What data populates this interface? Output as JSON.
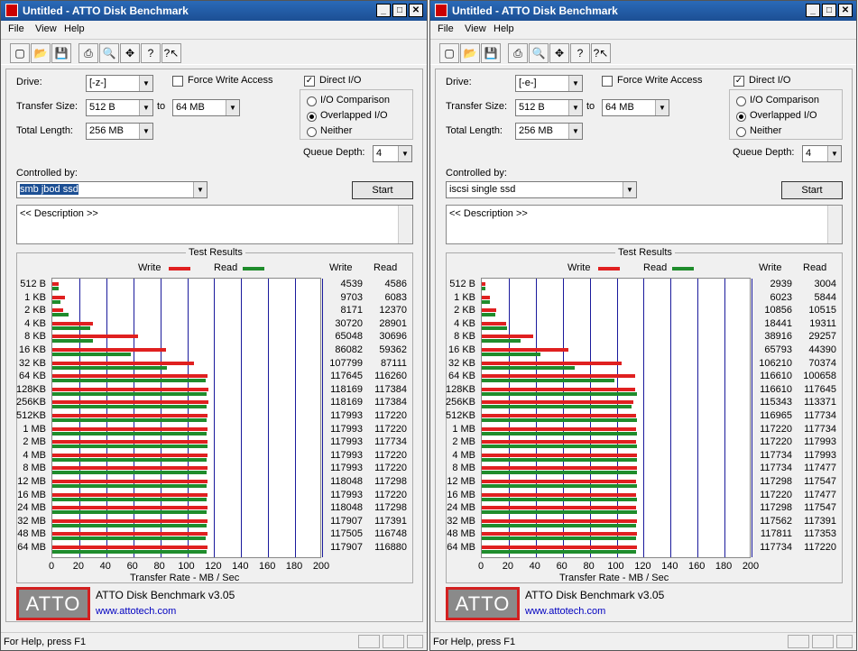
{
  "colors": {
    "write": "#e02020",
    "read": "#1f8c2c",
    "grid": "#1a1a9c"
  },
  "windows": [
    {
      "title": "Untitled - ATTO Disk Benchmark",
      "menu": [
        "File",
        "View",
        "Help"
      ],
      "drive_label": "Drive:",
      "drive": "[-z-]",
      "force_write_label": "Force Write Access",
      "direct_io_label": "Direct I/O",
      "transfer_size_label": "Transfer Size:",
      "ts_from": "512 B",
      "to_label": "to",
      "ts_to": "64 MB",
      "total_length_label": "Total Length:",
      "total_length": "256 MB",
      "io_comparison": "I/O Comparison",
      "overlapped": "Overlapped I/O",
      "neither": "Neither",
      "queue_depth_label": "Queue Depth:",
      "queue_depth": "4",
      "controlled_by_label": "Controlled by:",
      "controlled_by": "smb jbod ssd",
      "start_label": "Start",
      "description": "<< Description >>",
      "test_results_label": "Test Results",
      "write_label": "Write",
      "read_label": "Read",
      "x_axis_label": "Transfer Rate - MB / Sec",
      "product": "ATTO Disk Benchmark v3.05",
      "url": "www.attotech.com",
      "logo": "ATTO",
      "status": "For Help, press F1",
      "chart_data": {
        "type": "bar",
        "title": "Test Results",
        "xlabel": "Transfer Rate - MB / Sec",
        "xlim": [
          0,
          200
        ],
        "x_ticks": [
          "0",
          "20",
          "40",
          "60",
          "80",
          "100",
          "120",
          "140",
          "160",
          "180",
          "200"
        ],
        "categories": [
          "512 B",
          "1 KB",
          "2 KB",
          "4 KB",
          "8 KB",
          "16 KB",
          "32 KB",
          "64 KB",
          "128KB",
          "256KB",
          "512KB",
          "1 MB",
          "2 MB",
          "4 MB",
          "8 MB",
          "12 MB",
          "16 MB",
          "24 MB",
          "32 MB",
          "48 MB",
          "64 MB"
        ],
        "series": [
          {
            "name": "Write",
            "values": [
              "4539",
              "9703",
              "8171",
              "30720",
              "65048",
              "86082",
              "107799",
              "117645",
              "118169",
              "118169",
              "117993",
              "117993",
              "117993",
              "117993",
              "117993",
              "118048",
              "117993",
              "118048",
              "117907",
              "117505",
              "117907"
            ]
          },
          {
            "name": "Read",
            "values": [
              "4586",
              "6083",
              "12370",
              "28901",
              "30696",
              "59362",
              "87111",
              "116260",
              "117384",
              "117384",
              "117220",
              "117220",
              "117734",
              "117220",
              "117220",
              "117298",
              "117220",
              "117298",
              "117391",
              "116748",
              "116880"
            ]
          }
        ]
      }
    },
    {
      "title": "Untitled - ATTO Disk Benchmark",
      "menu": [
        "File",
        "View",
        "Help"
      ],
      "drive_label": "Drive:",
      "drive": "[-e-]",
      "force_write_label": "Force Write Access",
      "direct_io_label": "Direct I/O",
      "transfer_size_label": "Transfer Size:",
      "ts_from": "512 B",
      "to_label": "to",
      "ts_to": "64 MB",
      "total_length_label": "Total Length:",
      "total_length": "256 MB",
      "io_comparison": "I/O Comparison",
      "overlapped": "Overlapped I/O",
      "neither": "Neither",
      "queue_depth_label": "Queue Depth:",
      "queue_depth": "4",
      "controlled_by_label": "Controlled by:",
      "controlled_by": "iscsi single ssd",
      "start_label": "Start",
      "description": "<< Description >>",
      "test_results_label": "Test Results",
      "write_label": "Write",
      "read_label": "Read",
      "x_axis_label": "Transfer Rate - MB / Sec",
      "product": "ATTO Disk Benchmark v3.05",
      "url": "www.attotech.com",
      "logo": "ATTO",
      "status": "For Help, press F1",
      "chart_data": {
        "type": "bar",
        "title": "Test Results",
        "xlabel": "Transfer Rate - MB / Sec",
        "xlim": [
          0,
          200
        ],
        "x_ticks": [
          "0",
          "20",
          "40",
          "60",
          "80",
          "100",
          "120",
          "140",
          "160",
          "180",
          "200"
        ],
        "categories": [
          "512 B",
          "1 KB",
          "2 KB",
          "4 KB",
          "8 KB",
          "16 KB",
          "32 KB",
          "64 KB",
          "128KB",
          "256KB",
          "512KB",
          "1 MB",
          "2 MB",
          "4 MB",
          "8 MB",
          "12 MB",
          "16 MB",
          "24 MB",
          "32 MB",
          "48 MB",
          "64 MB"
        ],
        "series": [
          {
            "name": "Write",
            "values": [
              "2939",
              "6023",
              "10856",
              "18441",
              "38916",
              "65793",
              "106210",
              "116610",
              "116610",
              "115343",
              "116965",
              "117220",
              "117220",
              "117734",
              "117734",
              "117298",
              "117220",
              "117298",
              "117562",
              "117811",
              "117734"
            ]
          },
          {
            "name": "Read",
            "values": [
              "3004",
              "5844",
              "10515",
              "19311",
              "29257",
              "44390",
              "70374",
              "100658",
              "117645",
              "113371",
              "117734",
              "117734",
              "117993",
              "117993",
              "117477",
              "117547",
              "117477",
              "117547",
              "117391",
              "117353",
              "117220"
            ]
          }
        ]
      }
    }
  ]
}
